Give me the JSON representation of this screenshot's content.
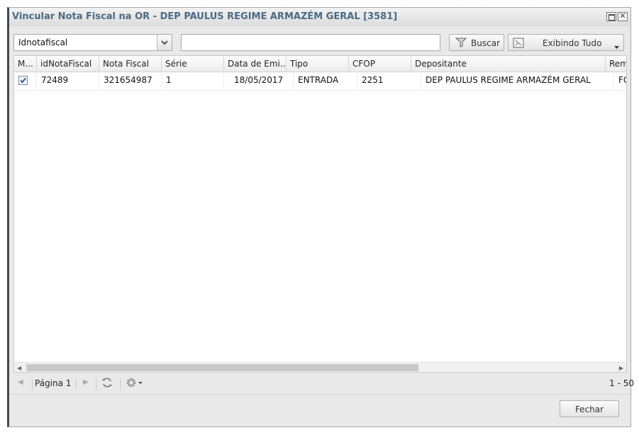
{
  "window": {
    "title": "Vincular Nota Fiscal na OR - DEP PAULUS REGIME ARMAZÉM GERAL [3581]"
  },
  "toolbar": {
    "field_select_value": "Idnotafiscal",
    "search_value": "",
    "search_button_label": "Buscar",
    "filter_button_label": "Exibindo Tudo"
  },
  "grid": {
    "columns": [
      "M...",
      "idNotaFiscal",
      "Nota Fiscal",
      "Série",
      "Data de Emi...",
      "Tipo",
      "CFOP",
      "Depositante",
      "Rem"
    ],
    "rows": [
      {
        "checked": true,
        "idNotaFiscal": "72489",
        "nota_fiscal": "321654987",
        "serie": "1",
        "data_emissao": "18/05/2017",
        "tipo": "ENTRADA",
        "cfop": "2251",
        "depositante": "DEP PAULUS REGIME ARMAZÉM GERAL",
        "remetente": "FC"
      }
    ]
  },
  "pager": {
    "page_label": "Página 1",
    "range_label": "1 - 50"
  },
  "footer": {
    "close_button_label": "Fechar"
  },
  "icons": {
    "search": "funnel-icon",
    "filter": "grid-icon",
    "refresh": "refresh-icon",
    "settings": "gear-icon"
  },
  "colors": {
    "title_text": "#4a6a85",
    "window_left_border": "#3d4a52"
  }
}
